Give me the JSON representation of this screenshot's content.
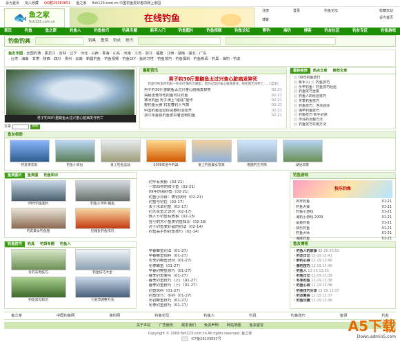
{
  "topbar": {
    "items": [
      "设为首页",
      "加入收藏",
      "QQ群25363651",
      "鱼之家",
      "fish123.com.cn 中国钓鱼爱好者的网上家园"
    ]
  },
  "logo": {
    "brand": "鱼之家",
    "url": "fish123.com.cn"
  },
  "banner": {
    "text": "在线钓鱼"
  },
  "toplinks": {
    "a": "注册",
    "b": "登录",
    "c": "钓鱼论坛",
    "d": "博客",
    "e": "收藏本站",
    "f": "设为首页"
  },
  "nav": [
    "首页",
    "钓鱼",
    "鱼之家",
    "钓鱼人",
    "钓鱼技巧",
    "钓具专题",
    "新手入门",
    "钓鱼图片",
    "钓鱼视频",
    "钓鱼论坛",
    "野钓",
    "海钓",
    "博客",
    "钓友社区",
    "钓友专区",
    "钓鱼游戏"
  ],
  "subnav": {
    "logo": "钓鱼钓具",
    "tags": [
      "钓具",
      "鱼饵",
      "钓点",
      "技巧"
    ]
  },
  "area": {
    "label": "鱼友乐园",
    "row1": "· 全国钓场 · 黑龙江 · 吉林 · 辽宁 · 河北 · 山西 · 青海 · 山东 · 河南 · 江苏 · 浙江 · 福建 · 江西 · 湖南 · 湖北 · 广东",
    "row2": "· 台湾 · 海南 · 甘肃 · 陕西 · 四川 · 贵州 · 云南 · 新疆钓鱼 · 钓鱼视频 · 钓鱼DIY · 鱼的习性 · 钓鱼技巧 · 钓鱼饵料 · 钓鱼新闻 · 钓具 · 海钓 · 钓友"
  },
  "featured": {
    "caption": "男子钓30斤重鲢鱼太过兴奋心脏病发作死亡"
  },
  "search": {
    "label": "文章",
    "button": "搜索"
  },
  "news": {
    "title": "最新资讯",
    "headline": "男子钓30斤重鲢鱼太过兴奋心脏病发猝死",
    "summary": "钓友在钓鱼时钓起一条30斤重的大鲢鱼，因为过度兴奋心脏病发作，经抢救无效死亡……[全文]",
    "items": [
      [
        "男子钓30斤重鲢鱼太过兴奋心脏病发猝死",
        "02-21"
      ],
      [
        "揭秘张誉所吃的鱼可以钓鱼",
        "02-21"
      ],
      [
        "被冰钓困  男子骑上“碰碰”报作",
        "02-21"
      ],
      [
        "野钓鱼大赛  钓友春钓人气高",
        "02-21"
      ],
      [
        "中国钓鱼运动协会春钓活动开",
        "02-21"
      ],
      [
        "浙江永嘉县钓鱼爱好者冒雨钓鱼",
        "02-21"
      ]
    ]
  },
  "recs": {
    "tabs": [
      "最新推荐",
      "热点文章",
      "推荐文章"
    ],
    "items": [
      "09年钓鱼技巧",
      "新手入门：钓鱼技巧",
      "手竿钓鱼：钓鱼技巧经验",
      "钓鱼技巧全集",
      "钓鱼人的经验技巧",
      "冬季钓鱼技巧",
      "钓鱼技巧：浮漂调漂",
      "海竿钓鱼技巧",
      "钓鱼技巧 新手必读",
      "浮漂的调整方法",
      "钓鱼技巧实用方法"
    ]
  },
  "album": {
    "title": "鱼友相册",
    "items": [
      "钓友亲恋影",
      "钓鱼小哥拉",
      "爱上钓鱼运动",
      "2009年金牛钓具",
      "爱上钓鱼美女写真",
      "南国钓王河南",
      "湖泊风景"
    ]
  },
  "left2": {
    "tabs": [
      "鱼类图片",
      "鱼类图",
      "钓鱼知识"
    ],
    "items": [
      "09年钓鱼图片",
      "钓鱼小河件·鲢鱼",
      "钓友美女钓鱼图",
      "红鲤鱼钓鱼技巧"
    ]
  },
  "mid2": {
    "items": [
      "· 钓竿有奥秘（02-21）",
      "· 一举四得的收小鱼（02-21）",
      "· 09年的海钓鱼（02-21）",
      "· 钓鱼小河段：美钓诀窍（02-21）",
      "· 钓鱼与钓位（02-17）",
      "· 关于水草钓鱼（02-17）",
      "· 钓大草鱼之诀窍（02-17）",
      "· 情人节钓鱼有故事（02-16）",
      "· 含小的大小鱼类钓鱼知识（02-16）",
      "· 对于钓鱼爱好者的钓法（02-14）",
      "· 钓鱼高手的钓鱼技巧（02-14）"
    ]
  },
  "right2": {
    "title": "钓鱼游戏",
    "ad": "快乐钓鱼",
    "items": [
      [
        "· 周末钓鱼",
        "01-21"
      ],
      [
        "· 钓鱼大赛",
        "01-21"
      ],
      [
        "· 钓鱼小游戏",
        "01-21"
      ],
      [
        "· 海钓小游戏 2009",
        "01-21"
      ],
      [
        "· 鲨鱼钓鱼",
        "01-21"
      ],
      [
        "· 快乐钓鱼",
        "01-21"
      ],
      [
        "· 钓鱼大师",
        "01-21"
      ],
      [
        "· 海底钓鱼",
        "01-21"
      ]
    ]
  },
  "left3": {
    "tabs": [
      "钓鱼技巧",
      "钓具",
      "钓饵专题",
      "钓鱼人"
    ],
    "items": [
      "冬钓实用技巧",
      "钓鱼技巧大全",
      "钓鱼常见知识",
      "七星漂调整方法"
    ]
  },
  "mid3": {
    "items": [
      "· 早春鲫鱼钓法（01-27）",
      "· 早春鲫鱼饵料（01-27）",
      "· 冬季钓鲫鱼诀窍（01-27）",
      "· 冬季鲫鱼（01-27）",
      "· 早春钓鲤鱼技巧（01-27）",
      "· 春季钓鱼要点（01-27）",
      "· 春季钓鱼技巧（上）（01-27）",
      "· 春季钓鱼技巧（下）（01-27）",
      "· 钓鱼窝料（01-27）",
      "· 钓鱼技巧：冬钓（01-27）",
      "· 冬钓鲫鱼技巧（01-27）",
      "· 冬季钓鱼技巧（01-27）"
    ]
  },
  "right3": {
    "title": "鱼友博客",
    "items": [
      [
        "· 钓鱼人的故事",
        "02-20 20:52"
      ],
      [
        "· 钓友日记",
        "12-19 13:41"
      ],
      [
        "· 野钓心得",
        "12-19 13:40"
      ],
      [
        "· 春钓技巧",
        "12-19 13:40"
      ],
      [
        "· 钓鱼人",
        "12-19 13:39"
      ],
      [
        "· 钓鱼日记",
        "12-19 13:39"
      ],
      [
        "· 冬季钓鱼",
        "12-19 13:38"
      ],
      [
        "· 钓鱼心得",
        "12-19 13:38"
      ],
      [
        "· 钓鱼技巧分享",
        "12-19 13:37"
      ],
      [
        "· 钓友聚会",
        "12-19 13:37"
      ],
      [
        "· 钓鱼乐趣",
        "12-19 13:36"
      ]
    ]
  },
  "links": [
    "鱼之家",
    "中国钓鱼网",
    "海钓网",
    "钓鱼论坛",
    "钓鱼人",
    "钓具",
    "钓鱼技巧",
    "鱼饵",
    "钓友"
  ],
  "footnav": [
    "关于本站",
    "广告服务",
    "联系我们",
    "免责声明",
    "网站地图",
    "鱼友留言"
  ],
  "copy": {
    "line1": "Copyright © 2009 fish123.com.cn All rights reserved. 鱼之家",
    "line2": "ICP备08109893号"
  },
  "watermark": {
    "a": "A5",
    "b": "下载",
    "c": "Down.admin5.com"
  }
}
